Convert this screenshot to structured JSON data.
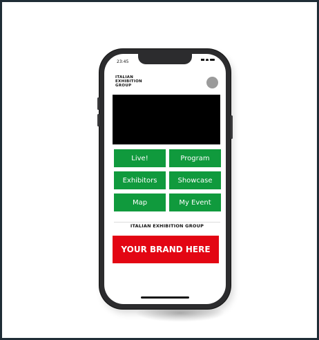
{
  "status_bar": {
    "time": "23:45"
  },
  "header": {
    "logo_lines": [
      "ITALIAN",
      "EXHIBITION",
      "GROUP"
    ]
  },
  "menu": {
    "tiles": [
      {
        "label": "Live!"
      },
      {
        "label": "Program"
      },
      {
        "label": "Exhibitors"
      },
      {
        "label": "Showcase"
      },
      {
        "label": "Map"
      },
      {
        "label": "My Event"
      }
    ]
  },
  "brand_strip": {
    "text": "ITALIAN EXHIBITION GROUP"
  },
  "banner": {
    "text": "YOUR BRAND HERE"
  },
  "colors": {
    "tile_green": "#109a3d",
    "banner_red": "#e30613",
    "frame_border": "#1f2d36"
  }
}
